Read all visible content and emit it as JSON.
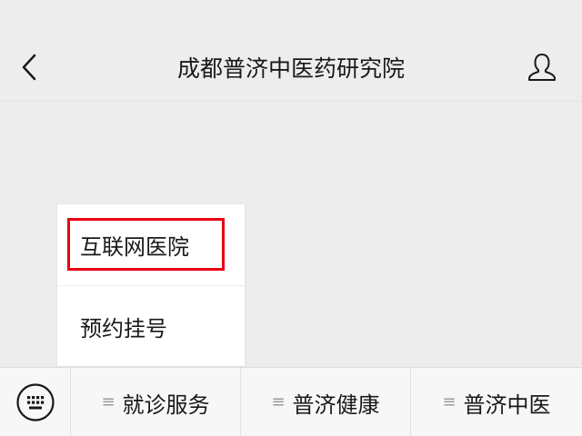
{
  "header": {
    "title": "成都普济中医药研究院",
    "back_icon": "chevron-left-icon",
    "profile_icon": "person-icon"
  },
  "popup_menu": {
    "items": [
      {
        "label": "互联网医院",
        "highlighted": true
      },
      {
        "label": "预约挂号",
        "highlighted": false
      }
    ],
    "highlight_color": "#e60012"
  },
  "bottom_bar": {
    "keyboard_icon": "keyboard-icon",
    "tabs": [
      {
        "icon": "menu-lines-icon",
        "label": "就诊服务"
      },
      {
        "icon": "menu-lines-icon",
        "label": "普济健康"
      },
      {
        "icon": "menu-lines-icon",
        "label": "普济中医"
      }
    ]
  },
  "colors": {
    "background": "#ededed",
    "text": "#191919",
    "highlight": "#e60012"
  }
}
